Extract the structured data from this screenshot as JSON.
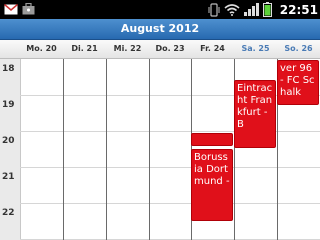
{
  "status_bar": {
    "time": "22:51",
    "left_icons": [
      "gmail-icon",
      "briefcase-icon"
    ],
    "right_icons": [
      "vibrate-icon",
      "wifi-icon",
      "signal-icon",
      "battery-icon"
    ]
  },
  "calendar": {
    "month_title": "August 2012",
    "days": [
      {
        "label": "Mo. 20",
        "weekend": false
      },
      {
        "label": "Di. 21",
        "weekend": false
      },
      {
        "label": "Mi. 22",
        "weekend": false
      },
      {
        "label": "Do. 23",
        "weekend": false
      },
      {
        "label": "Fr. 24",
        "weekend": false
      },
      {
        "label": "Sa. 25",
        "weekend": true
      },
      {
        "label": "So. 26",
        "weekend": true
      }
    ],
    "hours": [
      "18",
      "19",
      "20",
      "21",
      "22"
    ],
    "events": [
      {
        "day": "Fr. 24",
        "title": "",
        "start": "20:00",
        "end": "20:20"
      },
      {
        "day": "Fr. 24",
        "title": "Borussia Dortmund -",
        "start": "20:30",
        "end": "22:40"
      },
      {
        "day": "Sa. 25",
        "title": "Eintracht Frankfurt - B",
        "start": "18:30",
        "end": "20:10"
      },
      {
        "day": "So. 26",
        "title": "ver 96 - FC Schalk",
        "start": "18:00",
        "end": "19:15"
      }
    ]
  },
  "colors": {
    "event": "#e0101a",
    "header": "#2f73b8",
    "weekend_label": "#4a7bb5"
  }
}
